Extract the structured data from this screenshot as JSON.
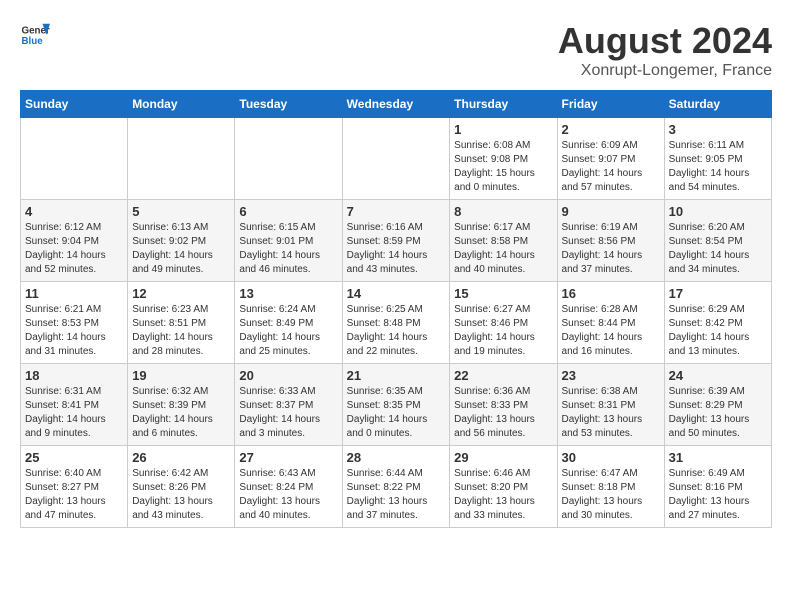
{
  "logo": {
    "general": "General",
    "blue": "Blue"
  },
  "title": "August 2024",
  "subtitle": "Xonrupt-Longemer, France",
  "days_of_week": [
    "Sunday",
    "Monday",
    "Tuesday",
    "Wednesday",
    "Thursday",
    "Friday",
    "Saturday"
  ],
  "weeks": [
    [
      {
        "day": "",
        "info": ""
      },
      {
        "day": "",
        "info": ""
      },
      {
        "day": "",
        "info": ""
      },
      {
        "day": "",
        "info": ""
      },
      {
        "day": "1",
        "info": "Sunrise: 6:08 AM\nSunset: 9:08 PM\nDaylight: 15 hours and 0 minutes."
      },
      {
        "day": "2",
        "info": "Sunrise: 6:09 AM\nSunset: 9:07 PM\nDaylight: 14 hours and 57 minutes."
      },
      {
        "day": "3",
        "info": "Sunrise: 6:11 AM\nSunset: 9:05 PM\nDaylight: 14 hours and 54 minutes."
      }
    ],
    [
      {
        "day": "4",
        "info": "Sunrise: 6:12 AM\nSunset: 9:04 PM\nDaylight: 14 hours and 52 minutes."
      },
      {
        "day": "5",
        "info": "Sunrise: 6:13 AM\nSunset: 9:02 PM\nDaylight: 14 hours and 49 minutes."
      },
      {
        "day": "6",
        "info": "Sunrise: 6:15 AM\nSunset: 9:01 PM\nDaylight: 14 hours and 46 minutes."
      },
      {
        "day": "7",
        "info": "Sunrise: 6:16 AM\nSunset: 8:59 PM\nDaylight: 14 hours and 43 minutes."
      },
      {
        "day": "8",
        "info": "Sunrise: 6:17 AM\nSunset: 8:58 PM\nDaylight: 14 hours and 40 minutes."
      },
      {
        "day": "9",
        "info": "Sunrise: 6:19 AM\nSunset: 8:56 PM\nDaylight: 14 hours and 37 minutes."
      },
      {
        "day": "10",
        "info": "Sunrise: 6:20 AM\nSunset: 8:54 PM\nDaylight: 14 hours and 34 minutes."
      }
    ],
    [
      {
        "day": "11",
        "info": "Sunrise: 6:21 AM\nSunset: 8:53 PM\nDaylight: 14 hours and 31 minutes."
      },
      {
        "day": "12",
        "info": "Sunrise: 6:23 AM\nSunset: 8:51 PM\nDaylight: 14 hours and 28 minutes."
      },
      {
        "day": "13",
        "info": "Sunrise: 6:24 AM\nSunset: 8:49 PM\nDaylight: 14 hours and 25 minutes."
      },
      {
        "day": "14",
        "info": "Sunrise: 6:25 AM\nSunset: 8:48 PM\nDaylight: 14 hours and 22 minutes."
      },
      {
        "day": "15",
        "info": "Sunrise: 6:27 AM\nSunset: 8:46 PM\nDaylight: 14 hours and 19 minutes."
      },
      {
        "day": "16",
        "info": "Sunrise: 6:28 AM\nSunset: 8:44 PM\nDaylight: 14 hours and 16 minutes."
      },
      {
        "day": "17",
        "info": "Sunrise: 6:29 AM\nSunset: 8:42 PM\nDaylight: 14 hours and 13 minutes."
      }
    ],
    [
      {
        "day": "18",
        "info": "Sunrise: 6:31 AM\nSunset: 8:41 PM\nDaylight: 14 hours and 9 minutes."
      },
      {
        "day": "19",
        "info": "Sunrise: 6:32 AM\nSunset: 8:39 PM\nDaylight: 14 hours and 6 minutes."
      },
      {
        "day": "20",
        "info": "Sunrise: 6:33 AM\nSunset: 8:37 PM\nDaylight: 14 hours and 3 minutes."
      },
      {
        "day": "21",
        "info": "Sunrise: 6:35 AM\nSunset: 8:35 PM\nDaylight: 14 hours and 0 minutes."
      },
      {
        "day": "22",
        "info": "Sunrise: 6:36 AM\nSunset: 8:33 PM\nDaylight: 13 hours and 56 minutes."
      },
      {
        "day": "23",
        "info": "Sunrise: 6:38 AM\nSunset: 8:31 PM\nDaylight: 13 hours and 53 minutes."
      },
      {
        "day": "24",
        "info": "Sunrise: 6:39 AM\nSunset: 8:29 PM\nDaylight: 13 hours and 50 minutes."
      }
    ],
    [
      {
        "day": "25",
        "info": "Sunrise: 6:40 AM\nSunset: 8:27 PM\nDaylight: 13 hours and 47 minutes."
      },
      {
        "day": "26",
        "info": "Sunrise: 6:42 AM\nSunset: 8:26 PM\nDaylight: 13 hours and 43 minutes."
      },
      {
        "day": "27",
        "info": "Sunrise: 6:43 AM\nSunset: 8:24 PM\nDaylight: 13 hours and 40 minutes."
      },
      {
        "day": "28",
        "info": "Sunrise: 6:44 AM\nSunset: 8:22 PM\nDaylight: 13 hours and 37 minutes."
      },
      {
        "day": "29",
        "info": "Sunrise: 6:46 AM\nSunset: 8:20 PM\nDaylight: 13 hours and 33 minutes."
      },
      {
        "day": "30",
        "info": "Sunrise: 6:47 AM\nSunset: 8:18 PM\nDaylight: 13 hours and 30 minutes."
      },
      {
        "day": "31",
        "info": "Sunrise: 6:49 AM\nSunset: 8:16 PM\nDaylight: 13 hours and 27 minutes."
      }
    ]
  ]
}
